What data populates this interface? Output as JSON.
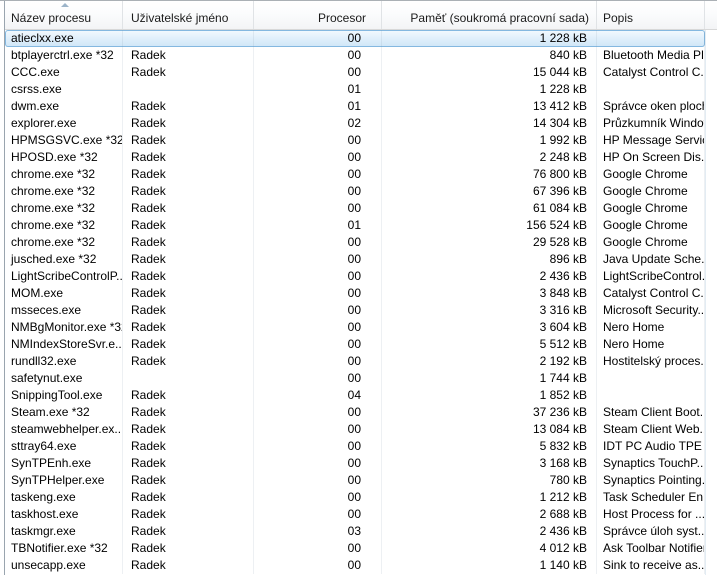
{
  "table": {
    "sort": {
      "column": "Název procesu",
      "direction": "ascending"
    },
    "columns": [
      {
        "label": "Název procesu",
        "align": "left"
      },
      {
        "label": "Uživatelské jméno",
        "align": "left"
      },
      {
        "label": "Procesor",
        "align": "right"
      },
      {
        "label": "Paměť (soukromá pracovní sada)",
        "align": "right"
      },
      {
        "label": "Popis",
        "align": "left"
      }
    ],
    "selected_index": 0,
    "rows": [
      {
        "name": "atieclxx.exe",
        "user": "",
        "cpu": "00",
        "mem": "1 228 kB",
        "desc": ""
      },
      {
        "name": "btplayerctrl.exe *32",
        "user": "Radek",
        "cpu": "00",
        "mem": "840 kB",
        "desc": "Bluetooth Media Pl..."
      },
      {
        "name": "CCC.exe",
        "user": "Radek",
        "cpu": "00",
        "mem": "15 044 kB",
        "desc": "Catalyst Control C..."
      },
      {
        "name": "csrss.exe",
        "user": "",
        "cpu": "01",
        "mem": "1 228 kB",
        "desc": ""
      },
      {
        "name": "dwm.exe",
        "user": "Radek",
        "cpu": "01",
        "mem": "13 412 kB",
        "desc": "Správce oken plochy"
      },
      {
        "name": "explorer.exe",
        "user": "Radek",
        "cpu": "02",
        "mem": "14 304 kB",
        "desc": "Průzkumník Windows"
      },
      {
        "name": "HPMSGSVC.exe *32",
        "user": "Radek",
        "cpu": "00",
        "mem": "1 992 kB",
        "desc": "HP Message Service"
      },
      {
        "name": "HPOSD.exe *32",
        "user": "Radek",
        "cpu": "00",
        "mem": "2 248 kB",
        "desc": "HP On Screen Dis..."
      },
      {
        "name": "chrome.exe *32",
        "user": "Radek",
        "cpu": "00",
        "mem": "76 800 kB",
        "desc": "Google Chrome"
      },
      {
        "name": "chrome.exe *32",
        "user": "Radek",
        "cpu": "00",
        "mem": "67 396 kB",
        "desc": "Google Chrome"
      },
      {
        "name": "chrome.exe *32",
        "user": "Radek",
        "cpu": "00",
        "mem": "61 084 kB",
        "desc": "Google Chrome"
      },
      {
        "name": "chrome.exe *32",
        "user": "Radek",
        "cpu": "01",
        "mem": "156 524 kB",
        "desc": "Google Chrome"
      },
      {
        "name": "chrome.exe *32",
        "user": "Radek",
        "cpu": "00",
        "mem": "29 528 kB",
        "desc": "Google Chrome"
      },
      {
        "name": "jusched.exe *32",
        "user": "Radek",
        "cpu": "00",
        "mem": "896 kB",
        "desc": "Java Update Sche..."
      },
      {
        "name": "LightScribeControlP...",
        "user": "Radek",
        "cpu": "00",
        "mem": "2 436 kB",
        "desc": "LightScribeControl..."
      },
      {
        "name": "MOM.exe",
        "user": "Radek",
        "cpu": "00",
        "mem": "3 848 kB",
        "desc": "Catalyst Control C..."
      },
      {
        "name": "msseces.exe",
        "user": "Radek",
        "cpu": "00",
        "mem": "3 316 kB",
        "desc": "Microsoft Security..."
      },
      {
        "name": "NMBgMonitor.exe *32",
        "user": "Radek",
        "cpu": "00",
        "mem": "3 604 kB",
        "desc": "Nero Home"
      },
      {
        "name": "NMIndexStoreSvr.e...",
        "user": "Radek",
        "cpu": "00",
        "mem": "5 512 kB",
        "desc": "Nero Home"
      },
      {
        "name": "rundll32.exe",
        "user": "Radek",
        "cpu": "00",
        "mem": "2 192 kB",
        "desc": "Hostitelský proces..."
      },
      {
        "name": "safetynut.exe",
        "user": "",
        "cpu": "00",
        "mem": "1 744 kB",
        "desc": ""
      },
      {
        "name": "SnippingTool.exe",
        "user": "Radek",
        "cpu": "04",
        "mem": "1 852 kB",
        "desc": ""
      },
      {
        "name": "Steam.exe *32",
        "user": "Radek",
        "cpu": "00",
        "mem": "37 236 kB",
        "desc": "Steam Client Boot..."
      },
      {
        "name": "steamwebhelper.ex...",
        "user": "Radek",
        "cpu": "00",
        "mem": "13 084 kB",
        "desc": "Steam Client Web..."
      },
      {
        "name": "sttray64.exe",
        "user": "Radek",
        "cpu": "00",
        "mem": "5 832 kB",
        "desc": "IDT PC Audio TPE"
      },
      {
        "name": "SynTPEnh.exe",
        "user": "Radek",
        "cpu": "00",
        "mem": "3 168 kB",
        "desc": "Synaptics TouchP..."
      },
      {
        "name": "SynTPHelper.exe",
        "user": "Radek",
        "cpu": "00",
        "mem": "780 kB",
        "desc": "Synaptics Pointing..."
      },
      {
        "name": "taskeng.exe",
        "user": "Radek",
        "cpu": "00",
        "mem": "1 212 kB",
        "desc": "Task Scheduler En..."
      },
      {
        "name": "taskhost.exe",
        "user": "Radek",
        "cpu": "00",
        "mem": "2 688 kB",
        "desc": "Host Process for ..."
      },
      {
        "name": "taskmgr.exe",
        "user": "Radek",
        "cpu": "03",
        "mem": "2 436 kB",
        "desc": "Správce úloh syst..."
      },
      {
        "name": "TBNotifier.exe *32",
        "user": "Radek",
        "cpu": "00",
        "mem": "4 012 kB",
        "desc": "Ask Toolbar Notifier"
      },
      {
        "name": "unsecapp.exe",
        "user": "Radek",
        "cpu": "00",
        "mem": "1 140 kB",
        "desc": "Sink to receive as..."
      }
    ]
  },
  "colors": {
    "selection_border": "#84b8e0",
    "selection_fill_top": "#f3fafe",
    "selection_fill_bottom": "#cfe6f7",
    "header_separator": "#e0e3e6",
    "header_bottom_border": "#d8d8d8",
    "sort_arrow": "#9cb4c9",
    "grid_line": "#ecf0f3"
  }
}
